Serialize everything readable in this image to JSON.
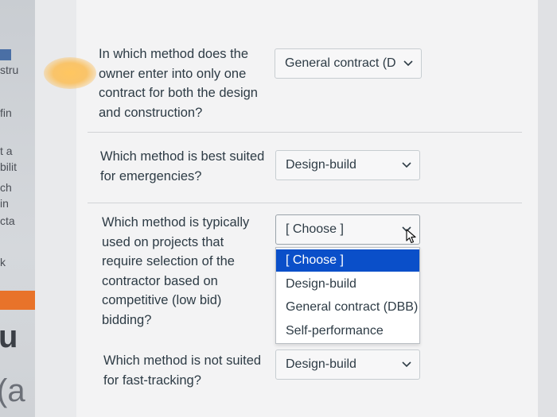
{
  "background_fragments": {
    "left_texts": [
      "stru",
      "fin",
      "t a",
      "bilit",
      "ch",
      "in",
      "cta",
      "k"
    ],
    "big_glyphs": [
      "u",
      "(a"
    ]
  },
  "questions": [
    {
      "lines": [
        "In which method does the",
        "owner enter into only one",
        "contract for both the design",
        "and construction?"
      ],
      "selected": "General contract (D"
    },
    {
      "lines": [
        "Which method is best suited",
        "for emergencies?"
      ],
      "selected": "Design-build"
    },
    {
      "lines": [
        "Which method is typically",
        "used on projects that",
        "require selection of the",
        "contractor based on",
        "competitive (low bid)",
        "bidding?"
      ],
      "selected": "[ Choose ]",
      "open": true,
      "options": [
        "[ Choose ]",
        "Design-build",
        "General contract (DBB)",
        "Self-performance"
      ],
      "highlighted_option": "[ Choose ]"
    },
    {
      "lines": [
        "Which method is not suited",
        "for fast-tracking?"
      ],
      "selected": "Design-build"
    }
  ],
  "colors": {
    "text": "#2d3b45",
    "highlight": "#0a4fc9",
    "orange_bar": "#e8732a"
  },
  "icons": {
    "select_arrow": "chevron-down-icon",
    "pointer": "mouse-cursor-icon"
  }
}
